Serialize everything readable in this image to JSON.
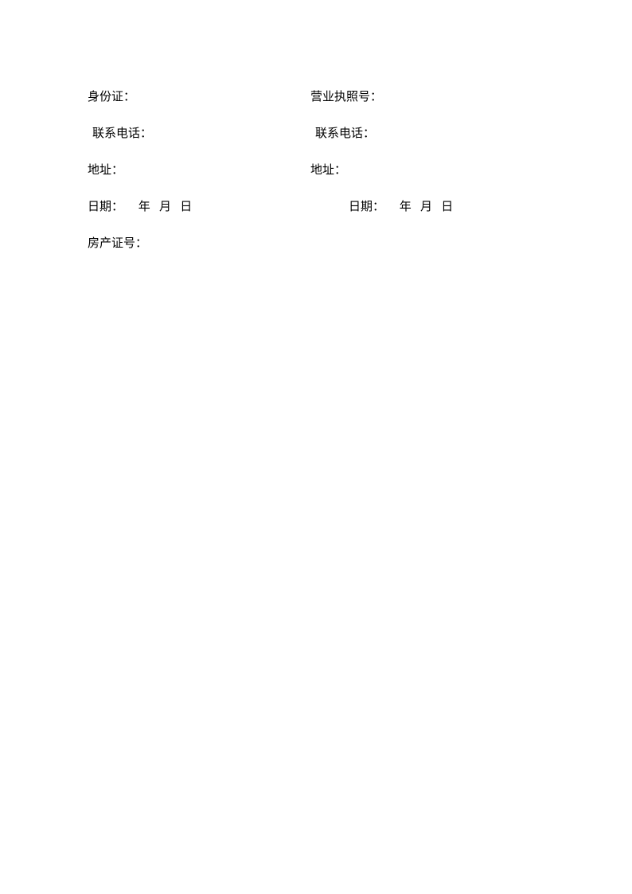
{
  "left": {
    "id_label": "身份证：",
    "phone_label": "联系电话：",
    "address_label": "地址：",
    "date_label": "日期：",
    "date_year": "年",
    "date_month": "月",
    "date_day": "日",
    "property_label": "房产证号："
  },
  "right": {
    "license_label": "营业执照号：",
    "phone_label": "联系电话：",
    "address_label": "地址：",
    "date_label": "日期：",
    "date_year": "年",
    "date_month": "月",
    "date_day": "日"
  }
}
